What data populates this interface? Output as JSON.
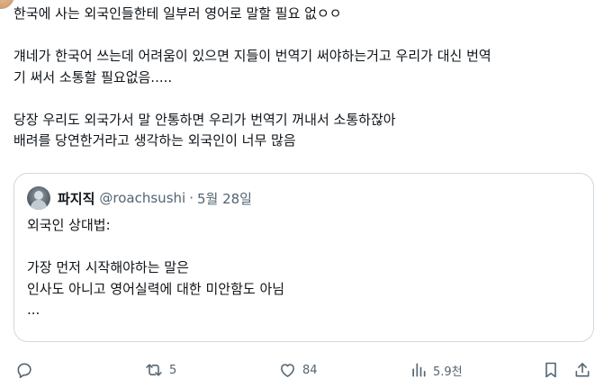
{
  "tweet": {
    "lines": [
      "한국에 사는 외국인들한테 일부러 영어로 말할 필요 없ㅇㅇ",
      "",
      "걔네가 한국어 쓰는데 어려움이 있으면 지들이 번역기 써야하는거고 우리가 대신 번역",
      "기 써서 소통할 필요없음.....",
      "",
      "당장 우리도 외국가서 말 안통하면 우리가 번역기 꺼내서 소통하잖아",
      "배려를 당연한거라고 생각하는 외국인이 너무 많음"
    ]
  },
  "quote": {
    "name": "파지직",
    "handle": "@roachsushi",
    "separator": "·",
    "date": "5월 28일",
    "lines": [
      "외국인 상대법:",
      "",
      "가장 먼저 시작해야하는 말은",
      "인사도 아니고 영어실력에 대한 미안함도 아님",
      "..."
    ]
  },
  "actions": {
    "reply_icon": "reply-icon",
    "retweet_icon": "retweet-icon",
    "retweet_count": "5",
    "like_icon": "heart-icon",
    "like_count": "84",
    "views_icon": "views-chart-icon",
    "views_count": "5.9천",
    "bookmark_icon": "bookmark-icon",
    "share_icon": "share-icon"
  },
  "colors": {
    "text": "#0f1419",
    "secondary": "#536471",
    "border": "#cfd9de"
  }
}
